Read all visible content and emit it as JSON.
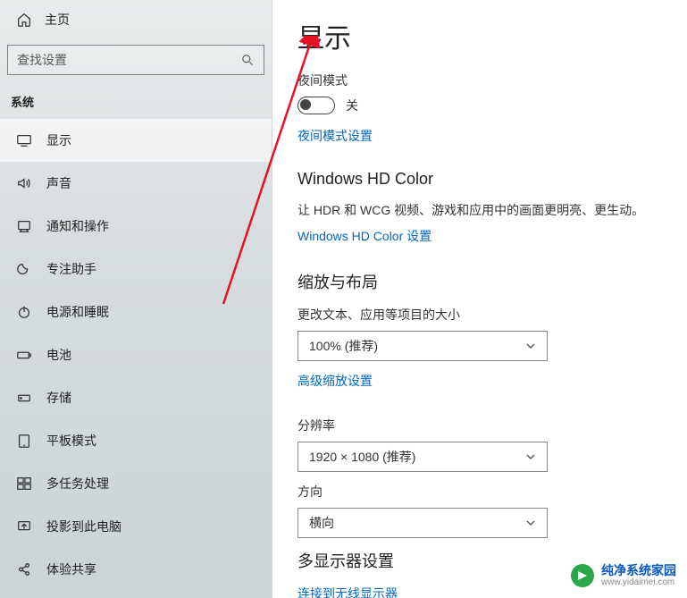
{
  "sidebar": {
    "home_label": "主页",
    "search_placeholder": "查找设置",
    "section_title": "系统",
    "items": [
      {
        "label": "显示",
        "icon": "display-icon"
      },
      {
        "label": "声音",
        "icon": "sound-icon"
      },
      {
        "label": "通知和操作",
        "icon": "notifications-icon"
      },
      {
        "label": "专注助手",
        "icon": "focus-icon"
      },
      {
        "label": "电源和睡眠",
        "icon": "power-icon"
      },
      {
        "label": "电池",
        "icon": "battery-icon"
      },
      {
        "label": "存储",
        "icon": "storage-icon"
      },
      {
        "label": "平板模式",
        "icon": "tablet-icon"
      },
      {
        "label": "多任务处理",
        "icon": "multitask-icon"
      },
      {
        "label": "投影到此电脑",
        "icon": "project-icon"
      },
      {
        "label": "体验共享",
        "icon": "share-icon"
      }
    ]
  },
  "main": {
    "title": "显示",
    "night_mode": {
      "label": "夜间模式",
      "toggle_state": "关",
      "link": "夜间模式设置"
    },
    "hd_color": {
      "heading": "Windows HD Color",
      "desc": "让 HDR 和 WCG 视频、游戏和应用中的画面更明亮、更生动。",
      "link": "Windows HD Color 设置"
    },
    "scale": {
      "heading": "缩放与布局",
      "scale_label": "更改文本、应用等项目的大小",
      "scale_value": "100% (推荐)",
      "advanced_link": "高级缩放设置",
      "resolution_label": "分辨率",
      "resolution_value": "1920 × 1080 (推荐)",
      "orientation_label": "方向",
      "orientation_value": "横向"
    },
    "multi": {
      "heading": "多显示器设置",
      "link": "连接到无线显示器"
    }
  },
  "watermark": {
    "name": "纯净系统家园",
    "url": "www.yidaimei.com"
  }
}
